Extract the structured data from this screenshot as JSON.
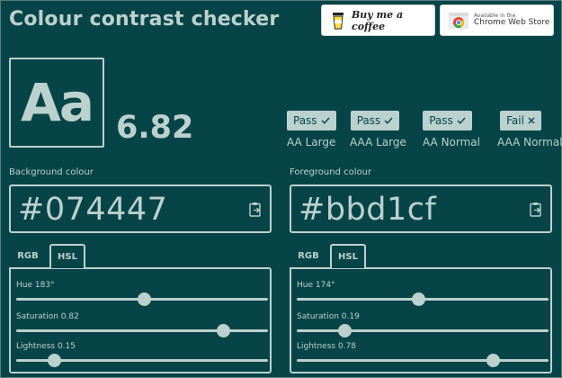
{
  "header": {
    "title": "Colour contrast checker",
    "coffee_label": "Buy me a coffee",
    "chrome_small": "Available in the",
    "chrome_big": "Chrome Web Store"
  },
  "preview": {
    "sample": "Aa",
    "ratio": "6.82"
  },
  "checks": [
    {
      "status": "Pass",
      "icon": "check-icon",
      "level": "AA Large"
    },
    {
      "status": "Pass",
      "icon": "check-icon",
      "level": "AAA Large"
    },
    {
      "status": "Pass",
      "icon": "check-icon",
      "level": "AA Normal"
    },
    {
      "status": "Fail",
      "icon": "cross-icon",
      "level": "AAA Normal"
    }
  ],
  "background": {
    "label": "Background colour",
    "hex": "#074447",
    "tabs": [
      "RGB",
      "HSL"
    ],
    "active_tab": "HSL",
    "sliders": [
      {
        "label": "Hue 183°",
        "value": 183,
        "max": 360
      },
      {
        "label": "Saturation 0.82",
        "value": 0.82,
        "max": 1
      },
      {
        "label": "Lightness 0.15",
        "value": 0.15,
        "max": 1
      }
    ]
  },
  "foreground": {
    "label": "Foreground colour",
    "hex": "#bbd1cf",
    "tabs": [
      "RGB",
      "HSL"
    ],
    "active_tab": "HSL",
    "sliders": [
      {
        "label": "Hue 174°",
        "value": 174,
        "max": 360
      },
      {
        "label": "Saturation 0.19",
        "value": 0.19,
        "max": 1
      },
      {
        "label": "Lightness 0.78",
        "value": 0.78,
        "max": 1
      }
    ]
  },
  "colors": {
    "page_background": "#074447",
    "foreground": "#bbd1cf"
  }
}
